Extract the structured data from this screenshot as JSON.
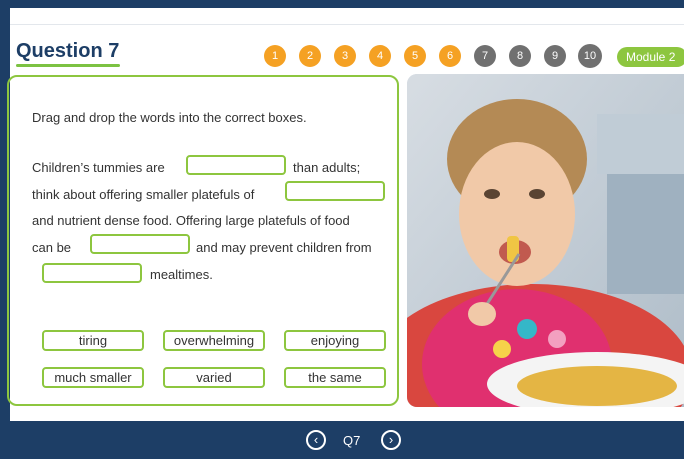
{
  "header": {
    "title": "Question 7",
    "progress": [
      "1",
      "2",
      "3",
      "4",
      "5",
      "6",
      "7",
      "8",
      "9",
      "10"
    ],
    "completed_count": 6,
    "module_label": "Module 2"
  },
  "question": {
    "instruction": "Drag and drop the words into the correct boxes.",
    "line1_a": "Children’s tummies are",
    "line1_b": "than adults;",
    "line2_a": "think about offering smaller platefuls of",
    "line3": "and nutrient dense food. Offering large platefuls of food",
    "line4_a": "can be",
    "line4_b": "and may prevent children from",
    "line5_b": "mealtimes."
  },
  "words": [
    "tiring",
    "overwhelming",
    "enjoying",
    "much smaller",
    "varied",
    "the same"
  ],
  "footer": {
    "question_label": "Q7"
  },
  "colors": {
    "navy": "#1d3e66",
    "green": "#8dc63f",
    "orange": "#f5a123",
    "grey": "#707070"
  },
  "icons": {
    "prev": "chevron-left-icon",
    "next": "chevron-right-icon"
  }
}
